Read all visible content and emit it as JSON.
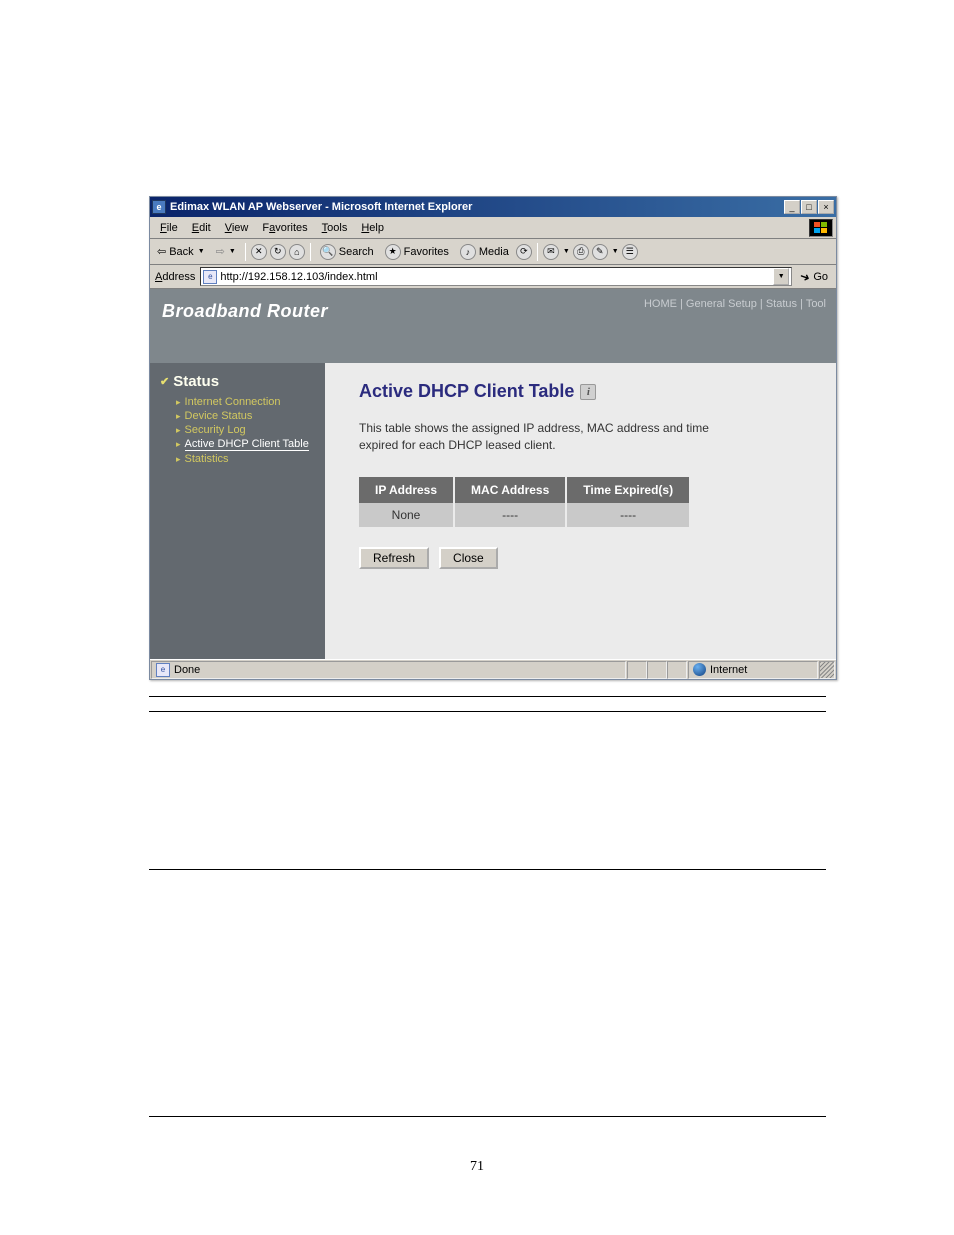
{
  "window": {
    "title": "Edimax WLAN AP Webserver - Microsoft Internet Explorer",
    "minimize": "_",
    "maximize": "□",
    "close": "×"
  },
  "menu": {
    "file": "File",
    "edit": "Edit",
    "view": "View",
    "favorites": "Favorites",
    "tools": "Tools",
    "help": "Help"
  },
  "toolbar": {
    "back": "Back",
    "search": "Search",
    "favorites": "Favorites",
    "media": "Media"
  },
  "addressbar": {
    "label": "Address",
    "url": "http://192.158.12.103/index.html",
    "go": "Go"
  },
  "brand": {
    "title": "Broadband Router",
    "nav": {
      "home": "HOME",
      "general": "General Setup",
      "status": "Status",
      "tool": "Tool"
    }
  },
  "sidebar": {
    "heading": "Status",
    "items": [
      {
        "label": "Internet Connection"
      },
      {
        "label": "Device Status"
      },
      {
        "label": "Security Log"
      },
      {
        "label": "Active DHCP Client Table"
      },
      {
        "label": "Statistics"
      }
    ],
    "active_index": 3
  },
  "main": {
    "title": "Active DHCP Client Table",
    "description": "This table shows the assigned IP address, MAC address and time expired for each DHCP leased client.",
    "columns": [
      "IP Address",
      "MAC Address",
      "Time Expired(s)"
    ],
    "row": [
      "None",
      "----",
      "----"
    ],
    "buttons": {
      "refresh": "Refresh",
      "close": "Close"
    }
  },
  "statusbar": {
    "done": "Done",
    "zone": "Internet"
  },
  "page_number": "71"
}
